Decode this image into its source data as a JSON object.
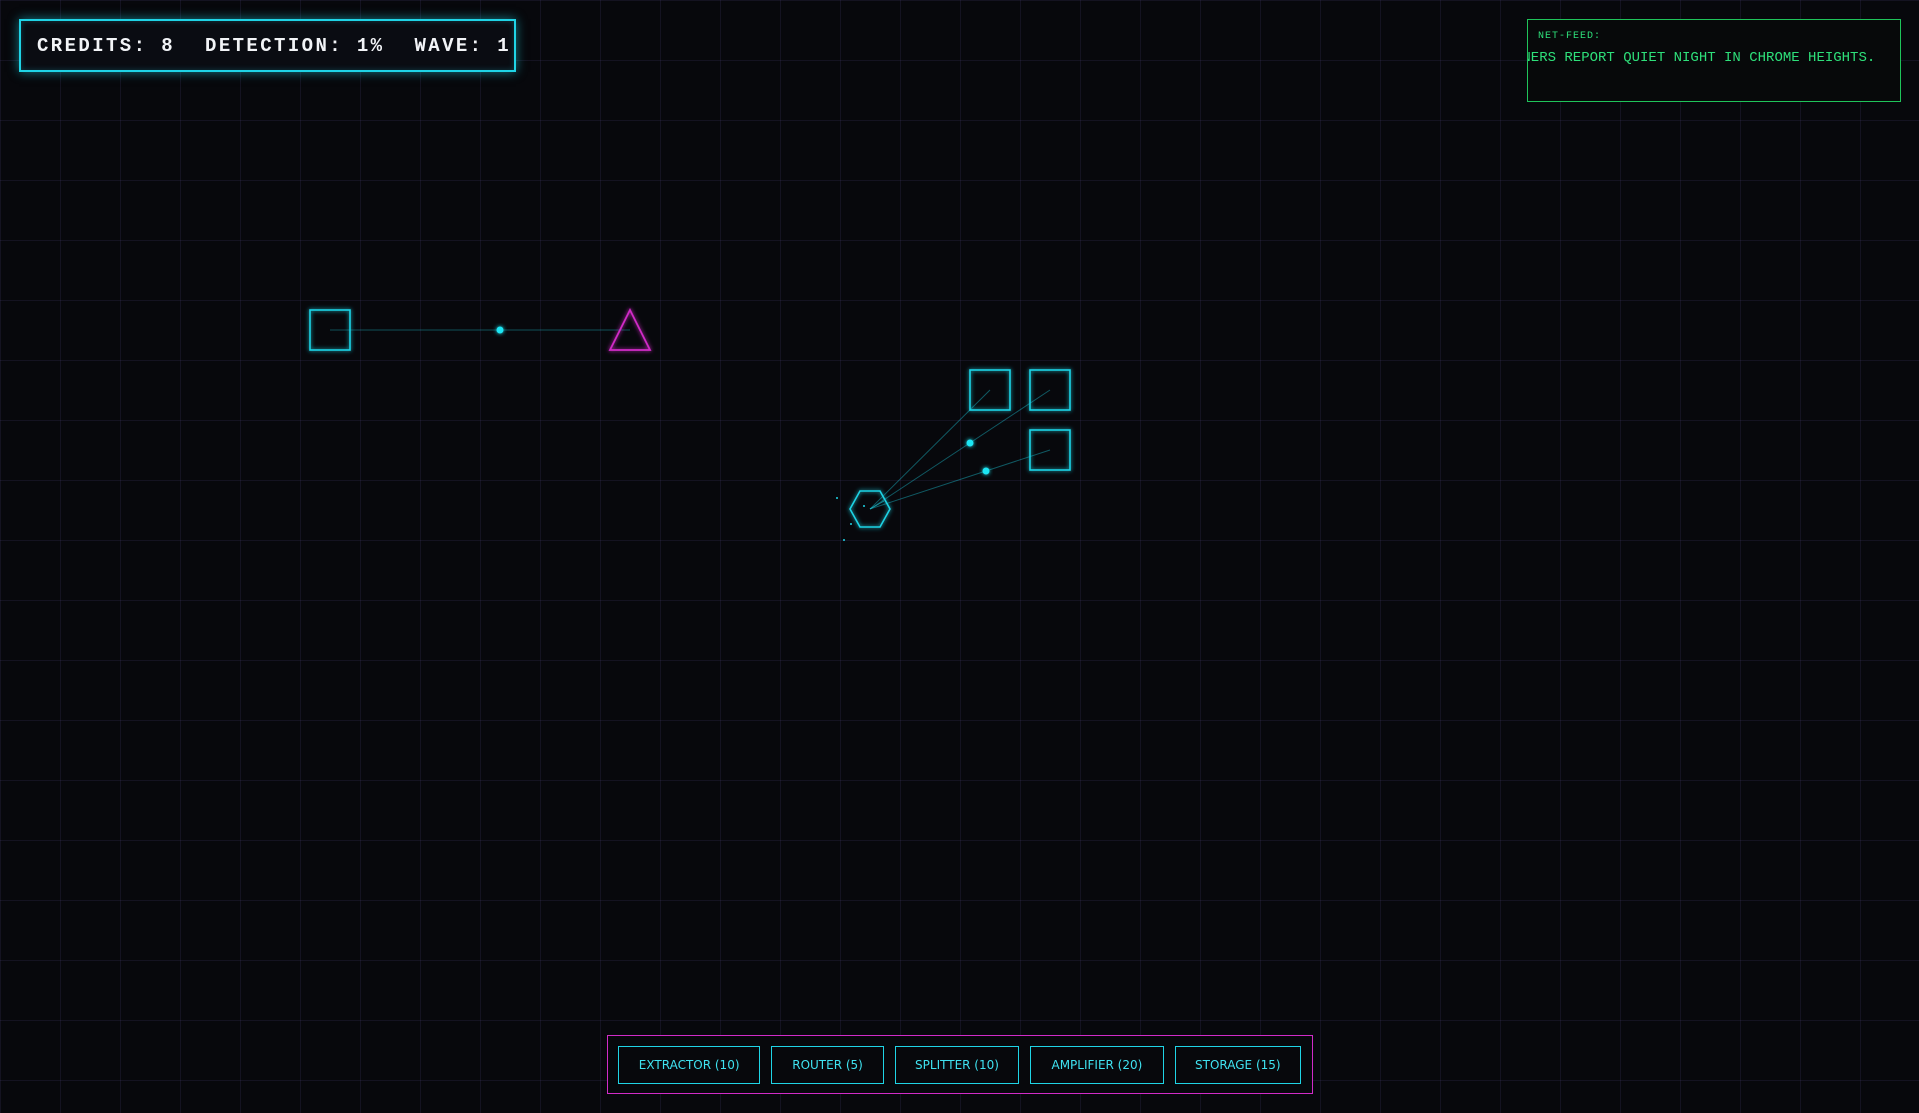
{
  "hud": {
    "credits_text": "CREDITS: 8",
    "detection_text": "DETECTION: 1%",
    "wave_text": "WAVE: 1"
  },
  "net_feed": {
    "title": "NET-FEED:",
    "message": "NNERS REPORT QUIET NIGHT IN CHROME HEIGHTS."
  },
  "build_menu": {
    "items": [
      {
        "label": "EXTRACTOR (10)"
      },
      {
        "label": "ROUTER (5)"
      },
      {
        "label": "SPLITTER (10)"
      },
      {
        "label": "AMPLIFIER (20)"
      },
      {
        "label": "STORAGE (15)"
      }
    ]
  },
  "colors": {
    "cyan": "#1fd4e6",
    "magenta": "#d12bc8",
    "feed_green": "#2ee07a",
    "background": "#07080c"
  },
  "entities": {
    "extractors": 4,
    "intruders": 1,
    "cores": 1
  }
}
